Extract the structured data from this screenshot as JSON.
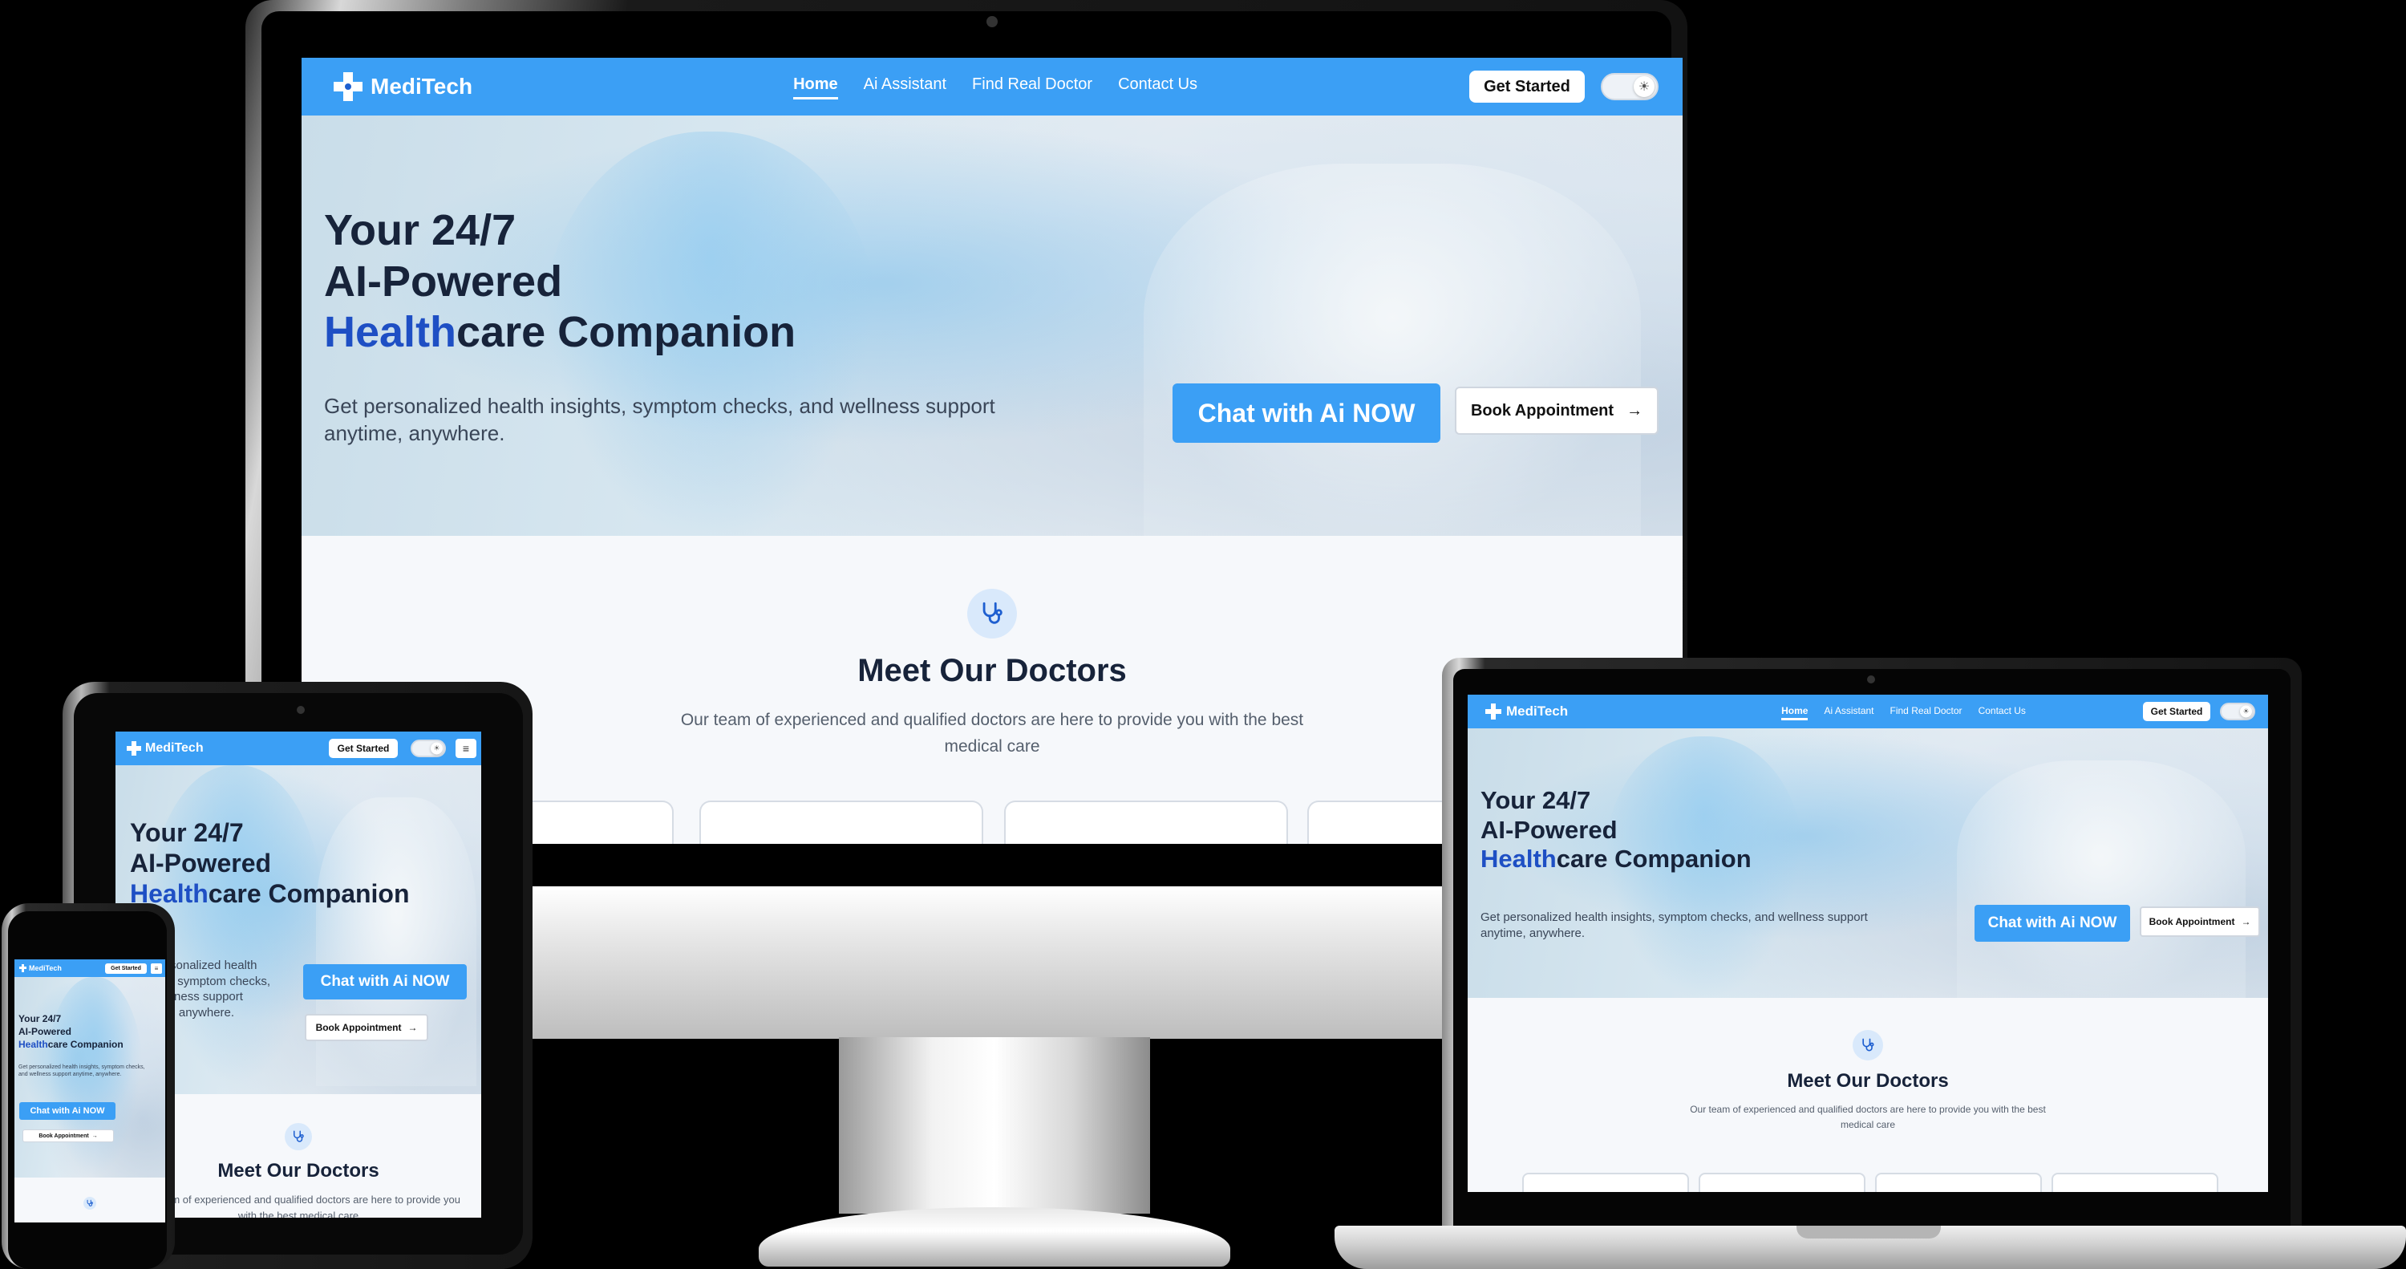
{
  "brand": {
    "name": "MediTech"
  },
  "nav": {
    "links": [
      "Home",
      "Ai Assistant",
      "Find Real Doctor",
      "Contact Us"
    ],
    "active_index": 0,
    "get_started": "Get Started",
    "theme_toggle_icon": "sun-icon",
    "menu_icon": "hamburger-menu-icon"
  },
  "hero": {
    "title_line1": "Your 24/7",
    "title_line2": "AI-Powered",
    "title_line3_highlight": "Health",
    "title_line3_rest": "care Companion",
    "subtitle": "Get personalized health insights, symptom checks, and wellness support anytime, anywhere.",
    "chat_button": "Chat with Ai NOW",
    "book_button": "Book Appointment",
    "book_arrow_icon": "arrow-right-icon"
  },
  "doctors": {
    "icon": "stethoscope-icon",
    "title": "Meet Our Doctors",
    "subtitle": "Our team of experienced and qualified doctors are here to provide you with the best medical care"
  },
  "colors": {
    "nav": "#3b9ff5",
    "accent": "#3b9ff5",
    "highlight": "#1e4fc4",
    "heading": "#17233a"
  }
}
